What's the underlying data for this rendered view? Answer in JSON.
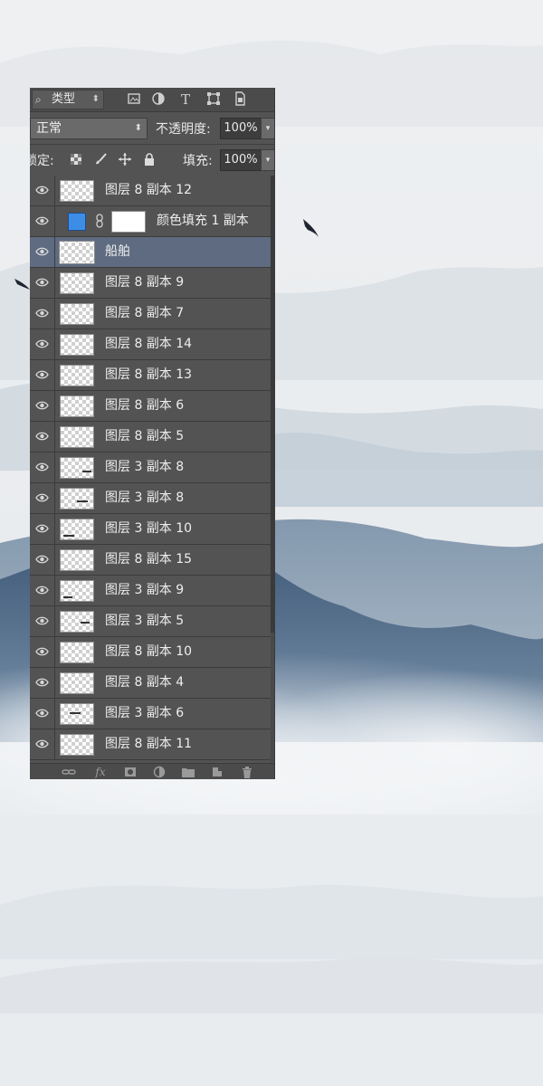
{
  "filter": {
    "search_icon": "search-icon",
    "kind_label": "类型"
  },
  "blend": {
    "mode": "正常",
    "opacity_label": "不透明度:",
    "opacity_value": "100%"
  },
  "lock": {
    "lock_label": "锁定:",
    "fill_label": "填充:",
    "fill_value": "100%"
  },
  "layers": [
    {
      "name": "图层 8 副本 12",
      "type": "pixel"
    },
    {
      "name": "颜色填充 1 副本",
      "type": "fill",
      "fill_color": "#3d8de6"
    },
    {
      "name": "船舶",
      "type": "pixel",
      "selected": true
    },
    {
      "name": "图层 8 副本 9",
      "type": "pixel"
    },
    {
      "name": "图层 8 副本 7",
      "type": "pixel"
    },
    {
      "name": "图层 8 副本 14",
      "type": "pixel"
    },
    {
      "name": "图层 8 副本 13",
      "type": "pixel"
    },
    {
      "name": "图层 8 副本 6",
      "type": "pixel"
    },
    {
      "name": "图层 8 副本 5",
      "type": "pixel"
    },
    {
      "name": "图层 3 副本 8",
      "type": "pixel"
    },
    {
      "name": "图层 3 副本 8",
      "type": "pixel"
    },
    {
      "name": "图层 3 副本 10",
      "type": "pixel"
    },
    {
      "name": "图层 8 副本 15",
      "type": "pixel"
    },
    {
      "name": "图层 3 副本 9",
      "type": "pixel"
    },
    {
      "name": "图层 3 副本 5",
      "type": "pixel"
    },
    {
      "name": "图层 8 副本 10",
      "type": "pixel"
    },
    {
      "name": "图层 8 副本 4",
      "type": "pixel"
    },
    {
      "name": "图层 3 副本 6",
      "type": "pixel"
    },
    {
      "name": "图层 8 副本 11",
      "type": "pixel"
    }
  ],
  "colors": {
    "panel": "#535353",
    "selected_row": "#5e6b80",
    "mountain_dark": "#3f5a77",
    "mist": "#e9ecef"
  }
}
